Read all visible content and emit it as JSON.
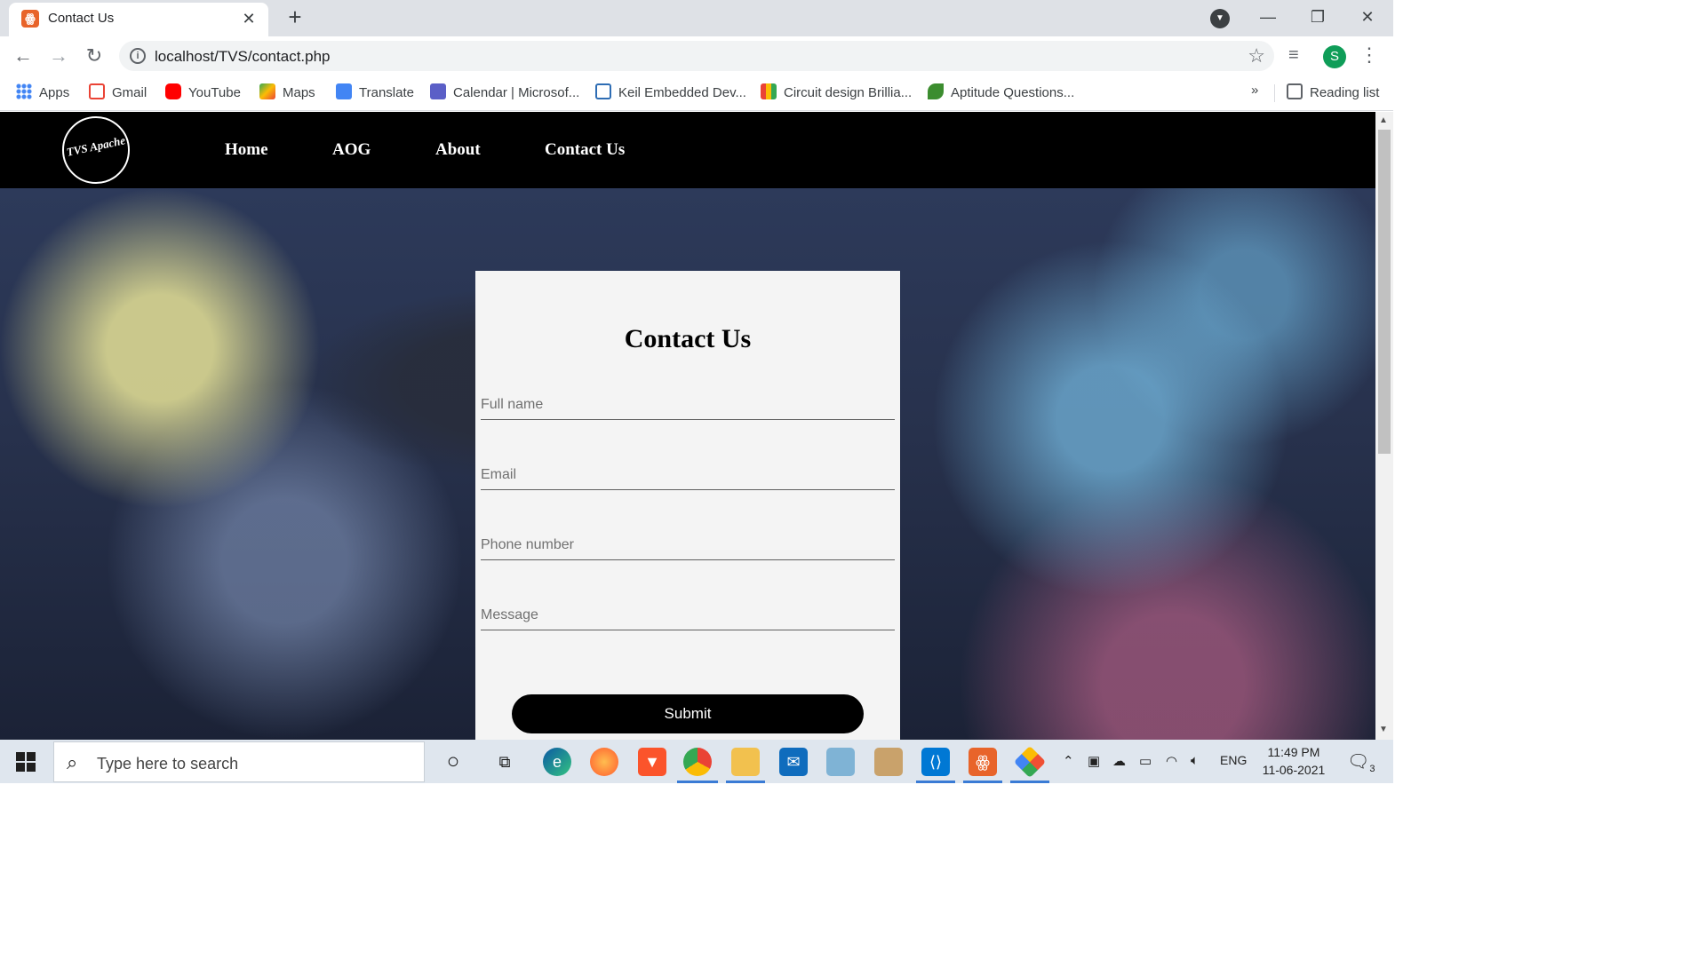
{
  "browser": {
    "tab_title": "Contact Us",
    "url": "localhost/TVS/contact.php",
    "profile_initial": "S"
  },
  "bookmarks": {
    "items": [
      {
        "label": "Apps",
        "icon": "apps-icon",
        "color": "#4285f4"
      },
      {
        "label": "Gmail",
        "icon": "gmail-icon",
        "color": "#ea4335"
      },
      {
        "label": "YouTube",
        "icon": "youtube-icon",
        "color": "#ff0000"
      },
      {
        "label": "Maps",
        "icon": "maps-icon",
        "color": "#34a853"
      },
      {
        "label": "Translate",
        "icon": "translate-icon",
        "color": "#4285f4"
      },
      {
        "label": "Calendar | Microsof...",
        "icon": "teams-icon",
        "color": "#5b5fc7"
      },
      {
        "label": "Keil Embedded Dev...",
        "icon": "keil-icon",
        "color": "#2e6db4"
      },
      {
        "label": "Circuit design Brillia...",
        "icon": "circuit-icon",
        "color": "#f4b400"
      },
      {
        "label": "Aptitude Questions...",
        "icon": "aptitude-icon",
        "color": "#3c8d2f"
      }
    ],
    "more": "»",
    "reading_list": "Reading list"
  },
  "site": {
    "logo_text": "TVS Apache",
    "nav": [
      "Home",
      "AOG",
      "About",
      "Contact Us"
    ]
  },
  "form": {
    "title": "Contact Us",
    "fields": [
      {
        "placeholder": "Full name"
      },
      {
        "placeholder": "Email"
      },
      {
        "placeholder": "Phone number"
      },
      {
        "placeholder": "Message"
      }
    ],
    "submit": "Submit"
  },
  "taskbar": {
    "search_placeholder": "Type here to search",
    "language": "ENG",
    "time": "11:49 PM",
    "date": "11-06-2021",
    "notifications": "3"
  }
}
